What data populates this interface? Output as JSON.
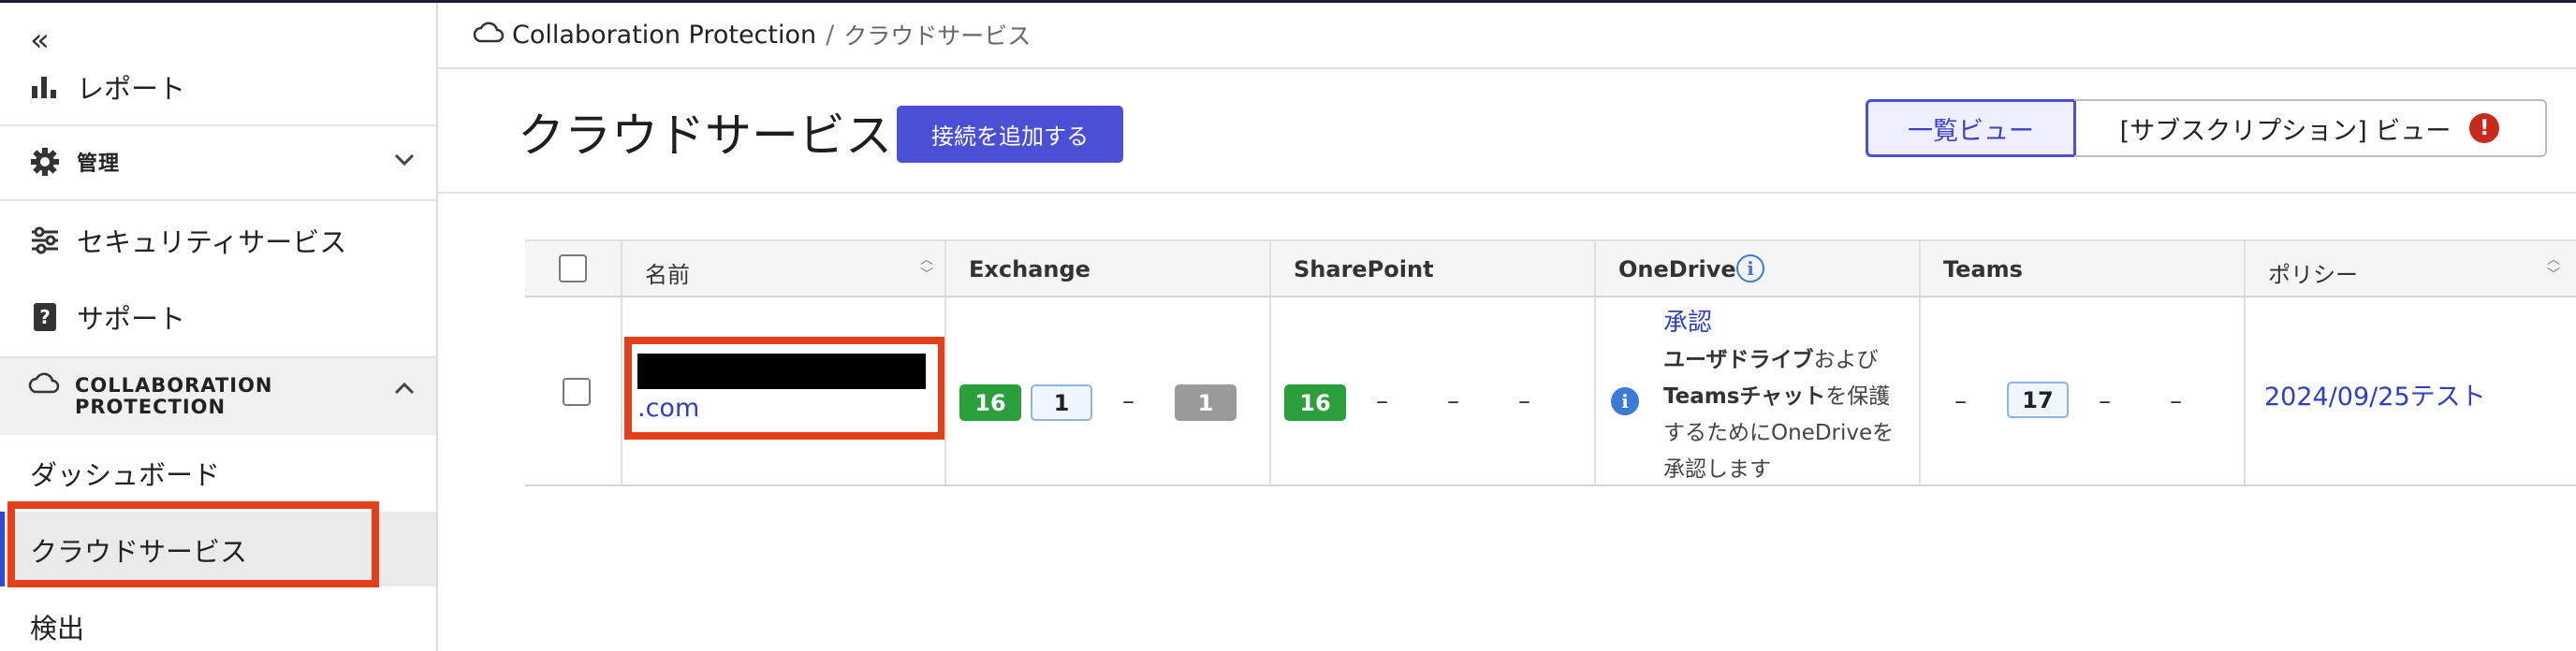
{
  "sidebar": {
    "collapse_icon": "double-chevron-left-icon",
    "report_label": "レポート",
    "admin_label": "管理",
    "security_services_label": "セキュリティサービス",
    "support_label": "サポート",
    "collab_label_line1": "COLLABORATION",
    "collab_label_line2": "PROTECTION",
    "sub_items": [
      "ダッシュボード",
      "クラウドサービス",
      "検出"
    ],
    "active_item": "クラウドサービス"
  },
  "breadcrumb": {
    "root": "Collaboration Protection",
    "separator": "/",
    "current": "クラウドサービス"
  },
  "header": {
    "title": "クラウドサービス",
    "add_button": "接続を追加する",
    "view_list": "一覧ビュー",
    "view_subscription": "[サブスクリプション] ビュー",
    "warning_mark": "!"
  },
  "table": {
    "columns": [
      "名前",
      "Exchange",
      "SharePoint",
      "OneDrive",
      "Teams",
      "ポリシー"
    ],
    "rows": [
      {
        "name_suffix": ".com",
        "exchange": {
          "green": "16",
          "outline": "1",
          "dash": "–",
          "gray": "1"
        },
        "sharepoint": {
          "green": "16",
          "dashes": [
            "–",
            "–",
            "–"
          ]
        },
        "onedrive": {
          "link": "承認",
          "text_bold1": "ユーザドライブ",
          "text_normal1": "および",
          "text_bold2": "Teamsチャット",
          "text_normal2": "を保護するためにOneDriveを承認します"
        },
        "teams": {
          "dash1": "–",
          "value": "17",
          "dash2": "–",
          "dash3": "–"
        },
        "policy": "2024/09/25テスト"
      }
    ]
  },
  "colors": {
    "accent": "#4a4fd6",
    "link": "#2e3fc4",
    "success": "#2a9f3c",
    "warning": "#c62a1b",
    "highlight": "#e2401b"
  }
}
